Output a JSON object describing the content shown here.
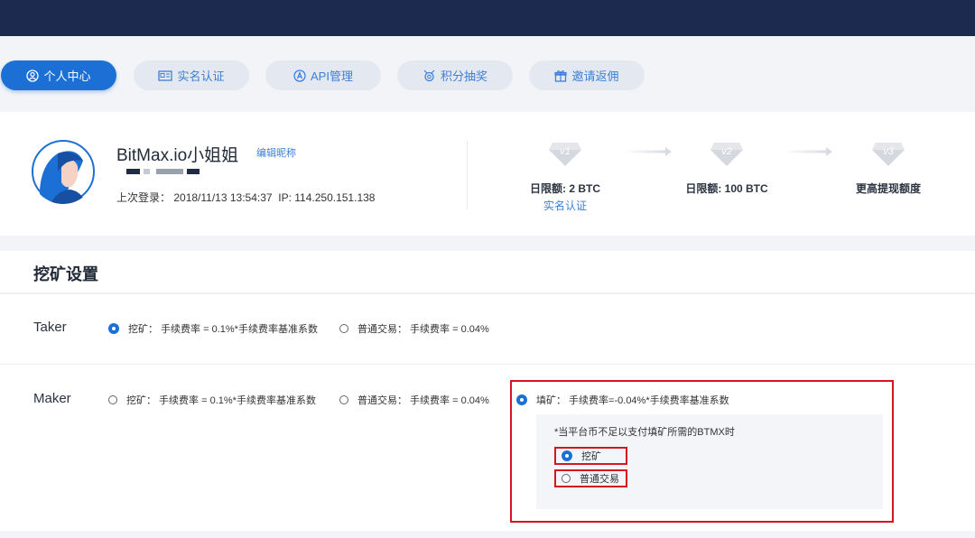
{
  "tabs": [
    {
      "label": "个人中心",
      "icon": "user-circle-icon",
      "active": true
    },
    {
      "label": "实名认证",
      "icon": "id-card-icon",
      "active": false
    },
    {
      "label": "API管理",
      "icon": "api-icon",
      "active": false
    },
    {
      "label": "积分抽奖",
      "icon": "lottery-icon",
      "active": false
    },
    {
      "label": "邀请返佣",
      "icon": "gift-icon",
      "active": false
    }
  ],
  "profile": {
    "username": "BitMax.io小姐姐",
    "edit_nickname": "编辑昵称",
    "last_login_label": "上次登录：",
    "last_login_time": "2018/11/13 13:54:37",
    "ip_label": "IP:",
    "ip": "114.250.151.138"
  },
  "levels": [
    {
      "badge": "v1",
      "limit": "日限额: 2 BTC",
      "link": "实名认证"
    },
    {
      "badge": "v2",
      "limit": "日限额: 100 BTC",
      "link": ""
    },
    {
      "badge": "v3",
      "limit": "更高提现额度",
      "link": ""
    }
  ],
  "mining": {
    "title": "挖矿设置",
    "taker": {
      "label": "Taker",
      "options": [
        {
          "text": "挖矿：  手续费率 = 0.1%*手续费率基准系数",
          "selected": true
        },
        {
          "text": "普通交易：  手续费率 = 0.04%",
          "selected": false
        }
      ]
    },
    "maker": {
      "label": "Maker",
      "options": [
        {
          "text": "挖矿：  手续费率 = 0.1%*手续费率基准系数",
          "selected": false
        },
        {
          "text": "普通交易：  手续费率 = 0.04%",
          "selected": false
        },
        {
          "text": "填矿：  手续费率=-0.04%*手续费率基准系数",
          "selected": true
        }
      ],
      "note": "*当平台币不足以支付填矿所需的BTMX时",
      "fallback_options": [
        {
          "text": "挖矿",
          "selected": true
        },
        {
          "text": "普通交易",
          "selected": false
        }
      ]
    }
  },
  "colors": {
    "navy": "#1b2a4e",
    "primary": "#1c6fd4",
    "highlight": "#d4171d"
  }
}
